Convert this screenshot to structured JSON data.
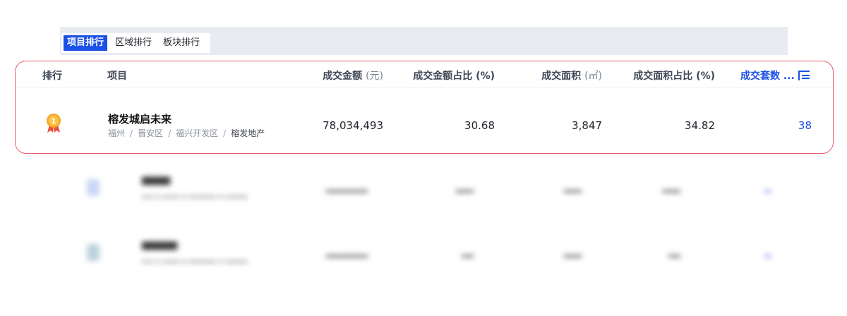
{
  "tabs": {
    "items": [
      {
        "label": "项目排行",
        "active": true
      },
      {
        "label": "区域排行",
        "active": false
      },
      {
        "label": "板块排行",
        "active": false
      }
    ]
  },
  "table": {
    "headers": {
      "rank": "排行",
      "project": "项目",
      "amount": "成交金额",
      "amount_unit": "(元)",
      "amount_share": "成交金额占比 (%)",
      "area": "成交面积",
      "area_unit": "(㎡)",
      "area_share": "成交面积占比 (%)",
      "units": "成交套数 ..."
    },
    "top_row": {
      "rank": 1,
      "name": "榕发城启未来",
      "city": "福州",
      "district": "晋安区",
      "zone": "福兴开发区",
      "developer": "榕发地产",
      "amount": "78,034,493",
      "amount_share": "30.68",
      "area": "3,847",
      "area_share": "34.82",
      "units": "38"
    }
  },
  "colors": {
    "accent": "#1a50e6",
    "highlight_border": "#e85d66",
    "medal": "#f5a623"
  }
}
